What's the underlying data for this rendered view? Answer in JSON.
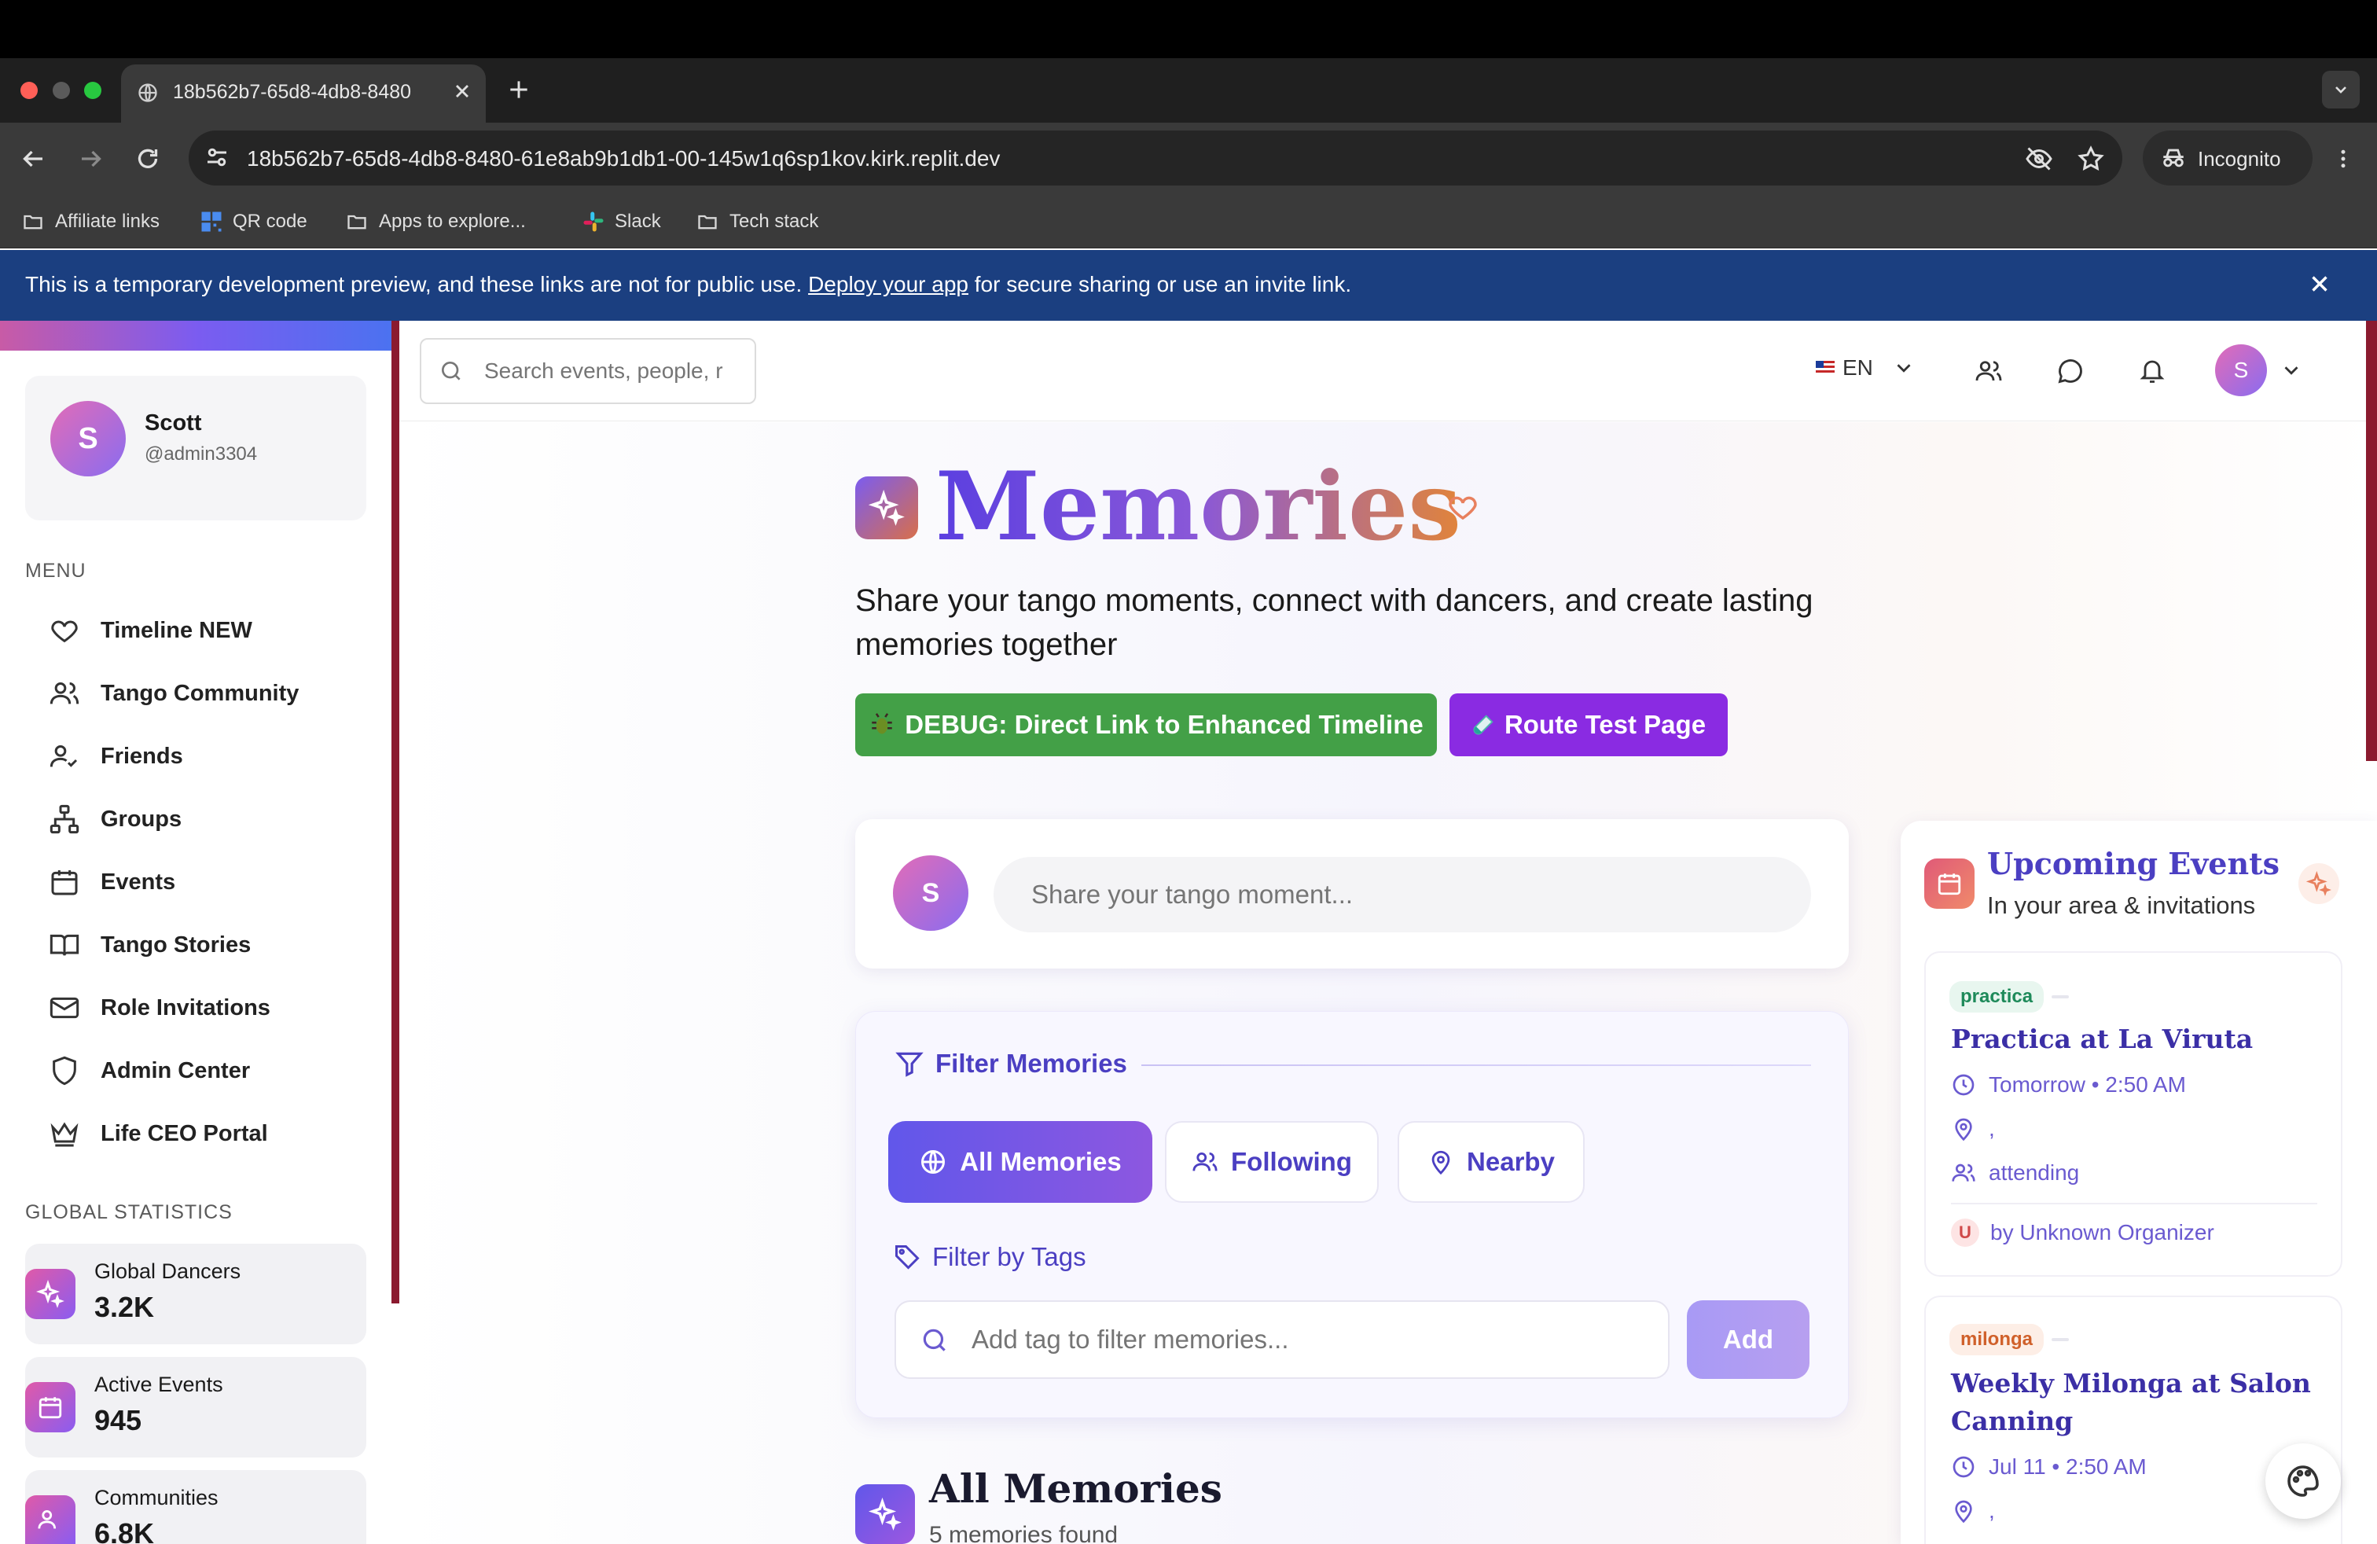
{
  "browser": {
    "tab_title": "18b562b7-65d8-4db8-8480",
    "url": "18b562b7-65d8-4db8-8480-61e8ab9b1db1-00-145w1q6sp1kov.kirk.replit.dev",
    "incognito_label": "Incognito",
    "bookmarks": [
      {
        "label": "Affiliate links",
        "icon": "folder-icon"
      },
      {
        "label": "QR code",
        "icon": "qr-icon"
      },
      {
        "label": "Apps to explore...",
        "icon": "folder-icon"
      },
      {
        "label": "Slack",
        "icon": "slack-icon"
      },
      {
        "label": "Tech stack",
        "icon": "folder-icon"
      }
    ]
  },
  "banner": {
    "text_before": "This is a temporary development preview, and these links are not for public use.",
    "link": "Deploy your app",
    "text_after": "for secure sharing or use an invite link."
  },
  "sidebar": {
    "user": {
      "initial": "S",
      "name": "Scott",
      "handle": "@admin3304"
    },
    "menu_label": "MENU",
    "items": [
      {
        "label": "Timeline NEW",
        "icon": "heart-icon"
      },
      {
        "label": "Tango Community",
        "icon": "users-icon"
      },
      {
        "label": "Friends",
        "icon": "user-check-icon"
      },
      {
        "label": "Groups",
        "icon": "network-icon"
      },
      {
        "label": "Events",
        "icon": "calendar-icon"
      },
      {
        "label": "Tango Stories",
        "icon": "book-icon"
      },
      {
        "label": "Role Invitations",
        "icon": "mail-icon"
      },
      {
        "label": "Admin Center",
        "icon": "shield-icon"
      },
      {
        "label": "Life CEO Portal",
        "icon": "crown-icon"
      }
    ],
    "stats_label": "GLOBAL STATISTICS",
    "stats": [
      {
        "label": "Global Dancers",
        "value": "3.2K",
        "icon": "sparkles-icon"
      },
      {
        "label": "Active Events",
        "value": "945",
        "icon": "calendar-icon"
      },
      {
        "label": "Communities",
        "value": "6.8K",
        "icon": "users-icon"
      }
    ]
  },
  "header": {
    "search_placeholder": "Search events, people, r",
    "language": "EN",
    "user_initial": "S"
  },
  "main": {
    "title": "Memories",
    "subtitle": "Share your tango moments, connect with dancers, and create lasting memories together",
    "debug_button": "DEBUG: Direct Link to Enhanced Timeline",
    "route_button": "Route Test Page",
    "composer": {
      "initial": "S",
      "placeholder": "Share your tango moment..."
    },
    "filter": {
      "title": "Filter Memories",
      "chips": [
        "All Memories",
        "Following",
        "Nearby"
      ],
      "tags_title": "Filter by Tags",
      "tag_placeholder": "Add tag to filter memories...",
      "add_label": "Add"
    },
    "memories_heading": "All Memories",
    "memories_count": "5 memories found"
  },
  "events": {
    "title": "Upcoming Events",
    "subtitle": "In your area & invitations",
    "items": [
      {
        "badge": "practica",
        "title": "Practica at La Viruta",
        "time": "Tomorrow • 2:50 AM",
        "location": ",",
        "status": "attending",
        "organizer_initial": "U",
        "organizer": "by Unknown Organizer"
      },
      {
        "badge": "milonga",
        "title": "Weekly Milonga at Salon Canning",
        "time": "Jul 11 • 2:50 AM",
        "location": ","
      }
    ]
  },
  "colors": {
    "accent": "#5b3fe0",
    "banner": "#1b3f80",
    "debug_green": "#43a047",
    "route_purple": "#8a2be2"
  }
}
